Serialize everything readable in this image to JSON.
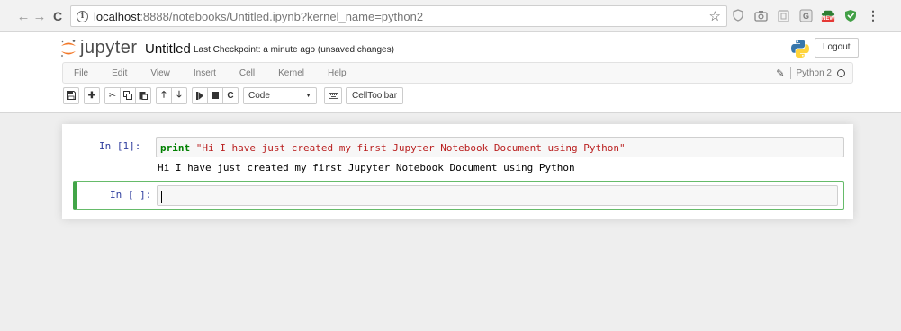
{
  "browser": {
    "url_host": "localhost",
    "url_path": ":8888/notebooks/Untitled.ipynb?kernel_name=python2",
    "ext_badge": "NEW"
  },
  "header": {
    "logo_text": "jupyter",
    "notebook_title": "Untitled",
    "checkpoint": "Last Checkpoint: a minute ago (unsaved changes)",
    "logout_label": "Logout"
  },
  "menu": {
    "items": [
      "File",
      "Edit",
      "View",
      "Insert",
      "Cell",
      "Kernel",
      "Help"
    ],
    "kernel_name": "Python 2"
  },
  "toolbar": {
    "cell_type": "Code",
    "celltoolbar_label": "CellToolbar",
    "icons": [
      "save-icon",
      "plus-icon",
      "cut-icon",
      "copy-icon",
      "paste-icon",
      "arrow-up-icon",
      "arrow-down-icon",
      "step-forward-icon",
      "stop-icon",
      "restart-icon",
      "keyboard-icon"
    ]
  },
  "cells": [
    {
      "prompt": "In [1]:",
      "keyword": "print",
      "string": "\"Hi I have just created my first Jupyter Notebook Document using Python\"",
      "output": "Hi I have just created my first Jupyter Notebook Document using Python"
    },
    {
      "prompt": "In [ ]:",
      "code": ""
    }
  ],
  "colors": {
    "prompt": "#303f9f",
    "keyword": "#008000",
    "string": "#ba2121",
    "selected_border": "#42a548",
    "jupyter_orange": "#f37726"
  }
}
